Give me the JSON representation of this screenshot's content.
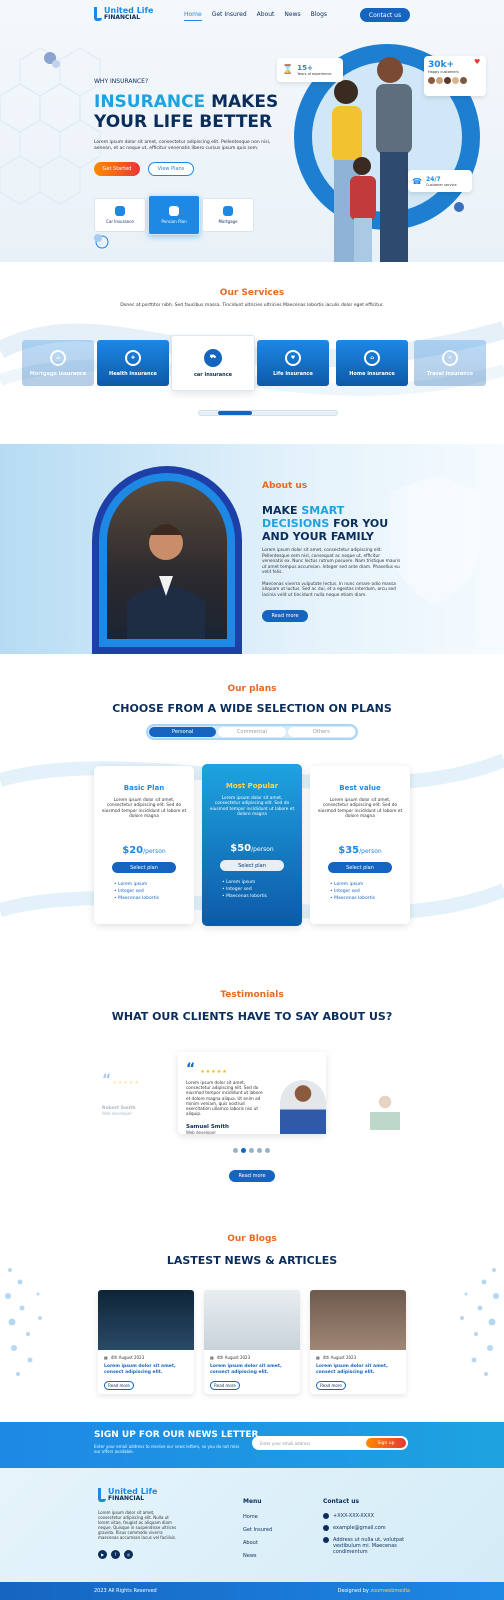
{
  "brand": {
    "name_1": "United Life",
    "name_2": "FINANCIAL"
  },
  "nav": {
    "items": [
      "Home",
      "Get Insured",
      "About",
      "News",
      "Blogs"
    ],
    "contact": "Contact us"
  },
  "hero": {
    "eyebrow": "WHY INSURANCE?",
    "title_blue": "INSURANCE",
    "title_rest_1": "MAKES",
    "title_rest_2": "YOUR LIFE BETTER",
    "text": "Lorem ipsum dolor sit amet, consectetur adipiscing elit. Pellentesque non nisi, aenean, et ac neque ut, efficitur venenatis libero cursus ipsum quis sem.",
    "btn_start": "Get Started",
    "btn_plans": "View Plans",
    "tabs": [
      "Car Insurance",
      "Pension Plan",
      "Mortgage"
    ],
    "stat1_num": "15+",
    "stat1_label": "Years of experience",
    "stat2_num": "30k+",
    "stat2_label": "Happy customers",
    "stat3_num": "24/7",
    "stat3_label": "Customer service"
  },
  "services": {
    "title": "Our Services",
    "subtitle": "Donec at porttitor nibh. Sed faucibus massa. Tincidunt ultricies ultricies Maecenas lobortis iaculis dolor eget efficitur.",
    "cards": [
      "Mortgage insurance",
      "Health insurance",
      "car insurance",
      "Life insurance",
      "Home insurance",
      "Travel insurance"
    ]
  },
  "about": {
    "title": "About us",
    "h_1": "MAKE",
    "h_blue": "SMART DECISIONS",
    "h_2": "FOR YOU AND YOUR FAMILY",
    "p1": "Lorem ipsum dolor sit amet, consectetur adipiscing elit. Pellentesque sem nisl, consequat ac neque ut, efficitur venenatis ex. Nunc lectus rutrum posuere. Nam tristique mauris ut amet tempus accumsan. Integer sed ante diam. Phasellus eu velit felis.",
    "p2": "Maecenas viverra vulputate lectus. In nunc ornare odio massa aliquam ut luctus. Sed ac dui, et a egestas interdum, arcu sed lacinia velit ut tincidunt nulla neque etiam diam.",
    "btn": "Read more"
  },
  "plans": {
    "title": "Our plans",
    "heading": "CHOOSE FROM A WIDE SELECTION ON PLANS",
    "tabs": [
      "Personal",
      "Commercial",
      "Others"
    ],
    "cards": [
      {
        "name": "Basic Plan",
        "desc": "Lorem ipsum dolor sit amet, consectetur adipiscing elit. Sed do eiusmod tempor incididunt ut labore et dolore magna",
        "price": "$20",
        "per": "/person",
        "btn": "Select plan",
        "features": [
          "Lorem ipsum",
          "Integer sed",
          "Maecenas lobortis"
        ]
      },
      {
        "name": "Most Popular",
        "desc": "Lorem ipsum dolor sit amet, consectetur adipiscing elit. Sed do eiusmod tempor incididunt ut labore et dolore magna",
        "price": "$50",
        "per": "/person",
        "btn": "Select plan",
        "features": [
          "Lorem ipsum",
          "Integer sed",
          "Maecenas lobortis"
        ]
      },
      {
        "name": "Best value",
        "desc": "Lorem ipsum dolor sit amet, consectetur adipiscing elit. Sed do eiusmod tempor incididunt ut labore et dolore magna",
        "price": "$35",
        "per": "/person",
        "btn": "Select plan",
        "features": [
          "Lorem ipsum",
          "Integer sed",
          "Maecenas lobortis"
        ]
      }
    ]
  },
  "testimonials": {
    "title": "Testimonials",
    "heading": "WHAT OUR CLIENTS HAVE TO SAY ABOUT US?",
    "stars": "★★★★★",
    "text": "Lorem ipsum dolor sit amet, consectetur adipiscing elit. Sed do eiusmod tempor incididunt ut labore et dolore magna aliqua. Ut enim ad minim veniam, quis nostrud exercitation ullamco laboris nisi ut aliquip.",
    "name": "Samuel Smith",
    "role": "Web developer",
    "ghost_name": "Robert Smith",
    "ghost_role": "Web developer",
    "btn": "Read more"
  },
  "blogs": {
    "title": "Our Blogs",
    "heading": "LASTEST NEWS & ARTICLES",
    "posts": [
      {
        "date": "4th August 2023",
        "title": "Lorem ipsum dolor sit amet, consect adipiscing elit.",
        "btn": "Read more"
      },
      {
        "date": "4th August 2023",
        "title": "Lorem ipsum dolor sit amet, consect adipiscing elit.",
        "btn": "Read more"
      },
      {
        "date": "4th August 2023",
        "title": "Lorem ipsum dolor sit amet, consect adipiscing elit.",
        "btn": "Read more"
      }
    ]
  },
  "newsletter": {
    "title": "SIGN UP FOR OUR NEWS LETTER",
    "text": "Enter your email address to receive our news letters, so you do not miss our offers available.",
    "placeholder": "Enter your email address",
    "btn": "Sign up"
  },
  "footer": {
    "about": "Lorem ipsum dolor sit amet, consectetur adipiscing elit. Nulla ut lorem vitae, feugiat ac aliquam diam neque. Quisque in suspendisse ultrices gravida. Risus commodo viverra maecenas accumsan lacus vel facilisis.",
    "menu_title": "Menu",
    "menu": [
      "Home",
      "Get Insured",
      "About",
      "News"
    ],
    "contact_title": "Contact us",
    "phone": "+XXX-XXX-XXXX",
    "email": "example@gmail.com",
    "address": "Address ut nulla ut, volutpat vestibulum mi. Maecenas condimentum",
    "copyright": "2023 All Rights Reserved",
    "designed_by": "Designed by",
    "designer": "zoomwebmedia"
  }
}
